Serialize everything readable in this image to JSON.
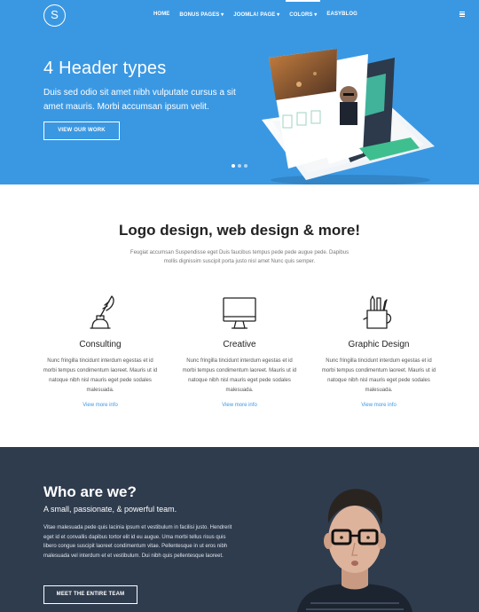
{
  "header": {
    "logo_letter": "S",
    "nav": [
      "HOME",
      "BONUS PAGES ▾",
      "JOOMLA! PAGE ▾",
      "COLORS ▾",
      "EASYBLOG"
    ]
  },
  "hero": {
    "title": "4 Header types",
    "text": "Duis sed odio sit amet nibh vulputate cursus a sit amet mauris. Morbi accumsan ipsum velit.",
    "button": "VIEW OUR WORK",
    "slides_total": 3,
    "slide_active": 1
  },
  "services": {
    "title": "Logo design, web design & more!",
    "subtitle": "Feugiat accumsan Suspendisse eget Duis faucibus tempus pede pede augue pede. Dapibus mollis dignissim suscipit porta justo nisl amet Nunc quis semper.",
    "items": [
      {
        "title": "Consulting",
        "text": "Nunc fringilla tincidunt interdum egestas et id morbi tempus condimentum laoreet. Mauris ut id natoque nibh nisl mauris eget pede sodales malesuada.",
        "link": "View more info",
        "icon": "inkwell-quill-icon"
      },
      {
        "title": "Creative",
        "text": "Nunc fringilla tincidunt interdum egestas et id morbi tempus condimentum laoreet. Mauris ut id natoque nibh nisl mauris eget pede sodales malesuada.",
        "link": "View more info",
        "icon": "monitor-icon"
      },
      {
        "title": "Graphic Design",
        "text": "Nunc fringilla tincidunt interdum egestas et id morbi tempus condimentum laoreet. Mauris ut id natoque nibh nisl mauris eget pede sodales malesuada.",
        "link": "View more info",
        "icon": "pencil-cup-icon"
      }
    ]
  },
  "team": {
    "title": "Who are we?",
    "subtitle": "A small, passionate, & powerful team.",
    "text": "Vitae malesuada pede quis lacinia ipsum et vestibulum in facilisi justo. Hendrerit eget id et convallis dapibus tortor elit id eu augue. Uma morbi tellus risus quis libero congue suscipit laoreet condimentum vitae. Pellentesque in ut eros nibh malesuada vel interdum et et vestibulum. Dui nibh quis pellentesque laoreet.",
    "button": "MEET THE ENTIRE TEAM"
  },
  "colors": {
    "hero_bg": "#3a98e3",
    "team_bg": "#2f3c4e",
    "accent": "#3a98e3"
  }
}
